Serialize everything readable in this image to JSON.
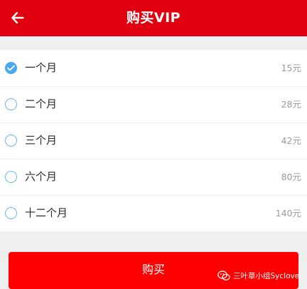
{
  "header": {
    "title": "购买VIP",
    "back_icon": "arrow-left-icon",
    "background_color": "#e0000f"
  },
  "plans": [
    {
      "name": "一个月",
      "price": "15元",
      "selected": true
    },
    {
      "name": "二个月",
      "price": "28元",
      "selected": false
    },
    {
      "name": "三个月",
      "price": "42元",
      "selected": false
    },
    {
      "name": "六个月",
      "price": "80元",
      "selected": false
    },
    {
      "name": "十二个月",
      "price": "140元",
      "selected": false
    }
  ],
  "buy_button": {
    "label": "购买",
    "color": "#ff0000"
  },
  "watermark": {
    "text": "三叶草小组Syclover",
    "icon": "wechat-icon"
  },
  "colors": {
    "radio_accent": "#4aa8ec"
  }
}
